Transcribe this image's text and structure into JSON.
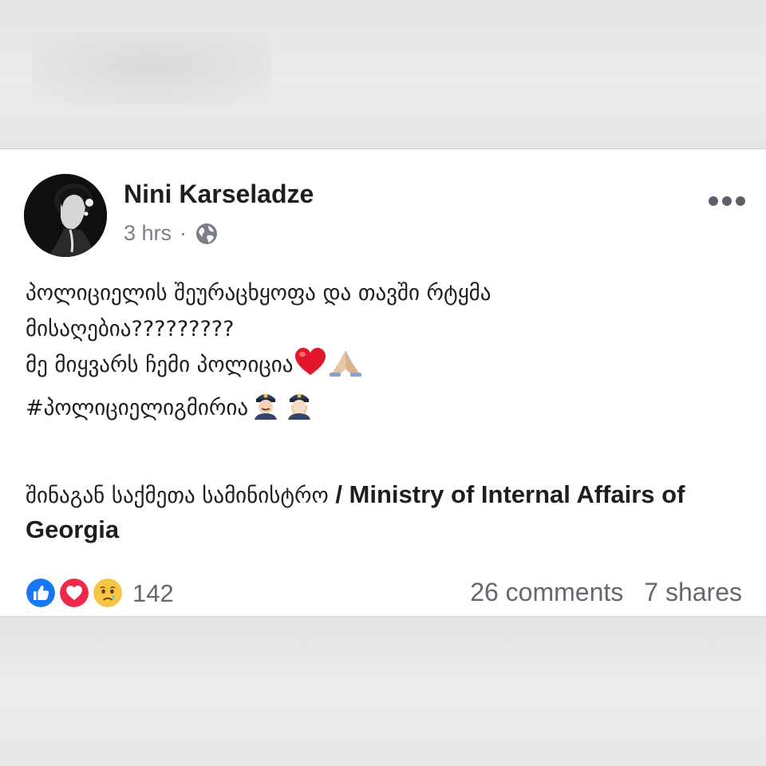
{
  "post": {
    "author": "Nini Karseladze",
    "time": "3 hrs",
    "separator": "·",
    "privacy_icon": "globe-icon",
    "more_icon": "ellipsis-icon",
    "lines": [
      "პოლიციელის შეურაცხყოფა და თავში რტყმა",
      "მისაღებია?????????",
      "მე მიყვარს ჩემი პოლიცია",
      "#პოლიციელიგმირია"
    ],
    "line3_emojis": [
      "red-heart-emoji",
      "folded-hands-emoji"
    ],
    "line4_emojis": [
      "police-officer-emoji",
      "police-officer-emoji"
    ],
    "page_mention_ka": "შინაგან საქმეთა სამინისტრო",
    "page_mention_en": " / Ministry of Internal Affairs of Georgia"
  },
  "footer": {
    "reaction_icons": [
      "like-icon",
      "love-icon",
      "sad-icon"
    ],
    "reaction_count": "142",
    "comments": "26 comments",
    "shares": "7 shares"
  },
  "colors": {
    "like": "#1877f2",
    "love": "#f0284a",
    "sad": "#f7c543",
    "text": "#1c1e21",
    "muted": "#65686d"
  }
}
